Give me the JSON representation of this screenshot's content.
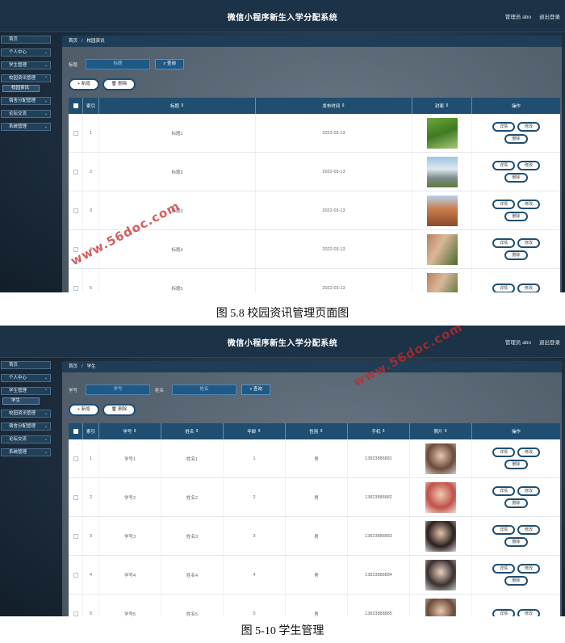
{
  "app": {
    "title": "微信小程序新生入学分配系统",
    "admin_label": "管理员 abo",
    "logout_label": "退出登录"
  },
  "sidebar1": {
    "items": [
      {
        "label": "首页"
      },
      {
        "label": "个人中心"
      },
      {
        "label": "学生管理"
      },
      {
        "label": "校园资讯管理"
      },
      {
        "label": "宿舍分配管理"
      },
      {
        "label": "论坛交流"
      },
      {
        "label": "系统管理"
      }
    ],
    "active_sub": "校园资讯"
  },
  "sidebar2": {
    "items": [
      {
        "label": "首页"
      },
      {
        "label": "个人中心"
      },
      {
        "label": "学生管理"
      },
      {
        "label": "校园资讯管理"
      },
      {
        "label": "宿舍分配管理"
      },
      {
        "label": "论坛交流"
      },
      {
        "label": "系统管理"
      }
    ],
    "active_sub": "学生"
  },
  "page1": {
    "breadcrumb": {
      "home": "首页",
      "sep": "/",
      "current": "校园资讯"
    },
    "search": {
      "label": "标题",
      "placeholder": "标题",
      "query": "查询"
    },
    "actions": {
      "add": "+ 新增",
      "delete": "删除"
    },
    "columns": [
      "索引",
      "标题",
      "发布时间",
      "封面",
      "操作"
    ],
    "rows": [
      {
        "index": "1",
        "title": "标题1",
        "date": "2022-03-13"
      },
      {
        "index": "2",
        "title": "标题2",
        "date": "2022-03-13"
      },
      {
        "index": "3",
        "title": "标题3",
        "date": "2022-03-13"
      },
      {
        "index": "4",
        "title": "标题4",
        "date": "2022-03-13"
      },
      {
        "index": "5",
        "title": "标题5",
        "date": "2022-03-13"
      }
    ],
    "ops": {
      "detail": "详情",
      "edit": "修改",
      "delete": "删除"
    }
  },
  "caption1": "图 5.8 校园资讯管理页面图",
  "page2": {
    "breadcrumb": {
      "home": "首页",
      "sep": "/",
      "current": "学生"
    },
    "search": {
      "label1": "学号",
      "placeholder1": "学号",
      "label2": "姓名",
      "placeholder2": "姓名",
      "query": "查询"
    },
    "actions": {
      "add": "+ 新增",
      "delete": "删除"
    },
    "columns": [
      "索引",
      "学号",
      "姓名",
      "年龄",
      "性别",
      "手机",
      "照片",
      "操作"
    ],
    "rows": [
      {
        "index": "1",
        "sid": "学号1",
        "name": "姓名1",
        "age": "1",
        "gender": "男",
        "phone": "13823888881"
      },
      {
        "index": "2",
        "sid": "学号2",
        "name": "姓名2",
        "age": "2",
        "gender": "男",
        "phone": "13823888882"
      },
      {
        "index": "3",
        "sid": "学号3",
        "name": "姓名3",
        "age": "3",
        "gender": "男",
        "phone": "13823888883"
      },
      {
        "index": "4",
        "sid": "学号4",
        "name": "姓名4",
        "age": "4",
        "gender": "男",
        "phone": "13823888884"
      },
      {
        "index": "5",
        "sid": "学号5",
        "name": "姓名5",
        "age": "5",
        "gender": "男",
        "phone": "13823888885"
      }
    ],
    "ops": {
      "detail": "详情",
      "edit": "修改",
      "delete": "删除"
    }
  },
  "caption2": "图 5-10 学生管理",
  "watermark": "www.56doc.com"
}
